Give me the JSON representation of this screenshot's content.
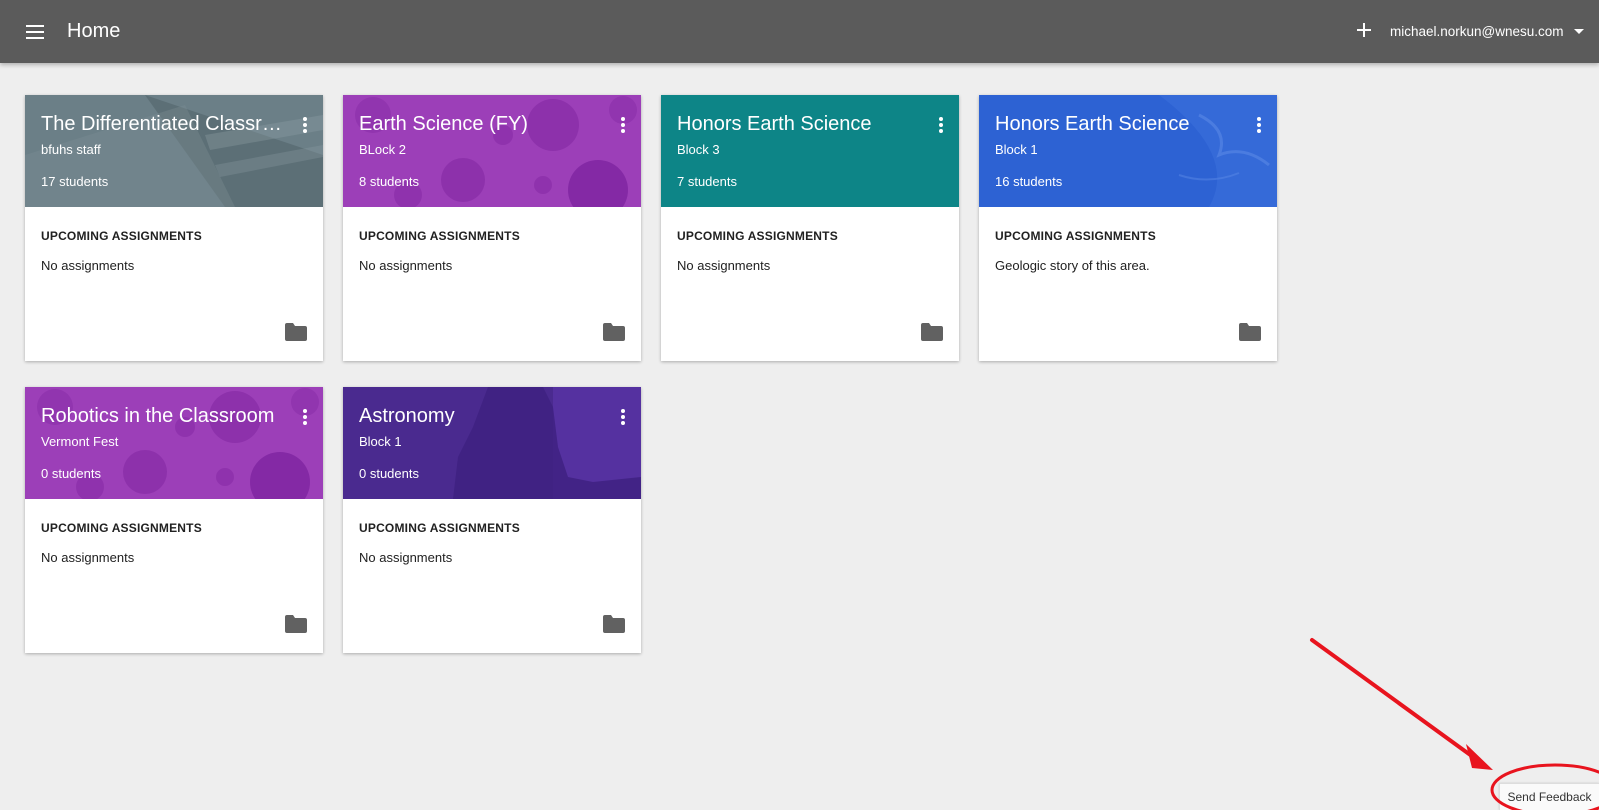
{
  "header": {
    "title": "Home",
    "account_email": "michael.norkun@wnesu.com",
    "menu_icon": "hamburger-menu-icon",
    "add_icon": "plus-icon"
  },
  "section_label": "UPCOMING ASSIGNMENTS",
  "classes": [
    {
      "title": "The Differentiated Classroom",
      "display_title": "The Differentiated Classro...",
      "section": "bfuhs staff",
      "students": "17 students",
      "assignment": "No assignments",
      "theme": "gray-book"
    },
    {
      "title": "Earth Science (FY)",
      "section": "BLock 2",
      "students": "8 students",
      "assignment": "No assignments",
      "theme": "purple-bubbles"
    },
    {
      "title": "Honors Earth Science",
      "section": "Block 3",
      "students": "7 students",
      "assignment": "No assignments",
      "theme": "teal"
    },
    {
      "title": "Honors Earth Science",
      "section": "Block 1",
      "students": "16 students",
      "assignment": "Geologic story of this area.",
      "theme": "blue-water"
    },
    {
      "title": "Robotics in the Classroom",
      "section": "Vermont Fest",
      "students": "0 students",
      "assignment": "No assignments",
      "theme": "purple-bubbles"
    },
    {
      "title": "Astronomy",
      "section": "Block 1",
      "students": "0 students",
      "assignment": "No assignments",
      "theme": "indigo-night"
    }
  ],
  "feedback_label": "Send Feedback",
  "colors": {
    "topbar": "#5b5b5b",
    "background": "#eeeeee",
    "gray_book": "#62757e",
    "purple": "#9c3fb8",
    "teal": "#0f8a8c",
    "blue": "#2d62d3",
    "indigo": "#4a2a8f",
    "annotation": "#e8141e"
  }
}
